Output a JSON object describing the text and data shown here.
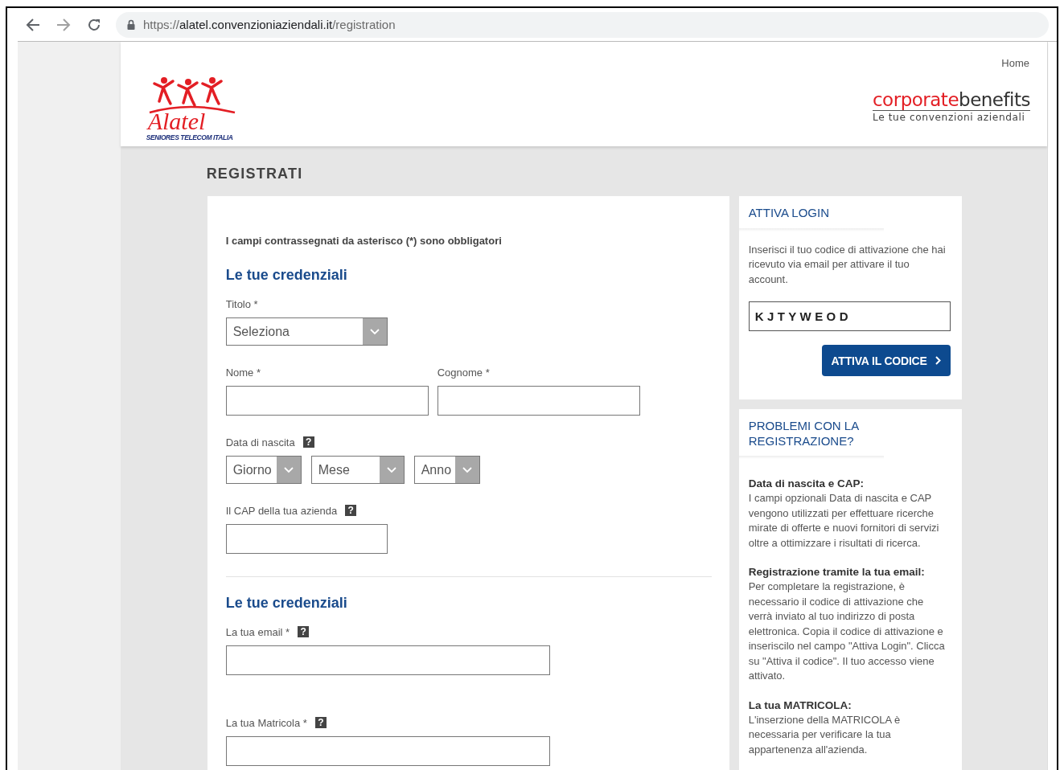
{
  "browser": {
    "url": {
      "scheme": "https://",
      "host": "alatel.convenzioniaziendali.it",
      "path": "/registration"
    }
  },
  "header": {
    "nav_link": "Home",
    "logo": {
      "name": "Alatel",
      "tagline": "SENIORES TELECOM ITALIA"
    },
    "brand": {
      "part_1": "corporate",
      "part_2": "benefits",
      "tagline": "Le tue convenzioni aziendali"
    }
  },
  "page_title": "REGISTRATI",
  "form": {
    "note": "I campi contrassegnati da asterisco (*) sono obbligatori",
    "sections": [
      {
        "heading": "Le tue credenziali",
        "fields": [
          {
            "kind": "select",
            "label": "Titolo *",
            "value": "Seleziona"
          },
          {
            "kind": "text-pair",
            "fields": [
              {
                "label": "Nome *"
              },
              {
                "label": "Cognome *"
              }
            ]
          },
          {
            "kind": "date",
            "label": "Data di nascita",
            "help": "?",
            "selects": [
              "Giorno",
              "Mese",
              "Anno"
            ]
          },
          {
            "kind": "short-text",
            "label": "Il CAP della tua azienda",
            "help": "?"
          }
        ]
      },
      {
        "heading": "Le tue credenziali",
        "fields": [
          {
            "kind": "text",
            "label": "La tua email *",
            "help": "?"
          },
          {
            "kind": "text",
            "label": "La tua Matricola *",
            "help": "?"
          }
        ]
      }
    ]
  },
  "sidebar": [
    {
      "kind": "activation",
      "title": "ATTIVA LOGIN",
      "text": "Inserisci il tuo codice di attivazione che hai ricevuto via email per attivare il tuo account.",
      "code": "KJTYWEOD",
      "button": "ATTIVA IL CODICE"
    },
    {
      "kind": "help",
      "title": "PROBLEMI CON LA REGISTRAZIONE?",
      "items": [
        {
          "heading": "Data di nascita e CAP:",
          "text": "I campi opzionali Data di nascita e CAP vengono utilizzati per effettuare ricerche mirate di offerte e nuovi fornitori di servizi oltre a ottimizzare i risultati di ricerca."
        },
        {
          "heading": "Registrazione tramite la tua email:",
          "text": "Per completare la registrazione, è necessario il codice di attivazione che verrà inviato al tuo indirizzo di posta elettronica. Copia il codice di attivazione e inseriscilo nel campo \"Attiva Login\". Clicca su \"Attiva il codice\". Il tuo accesso viene attivato."
        },
        {
          "heading": "La tua MATRICOLA:",
          "text": "L'inserzione della MATRICOLA è necessaria per verificare la tua appartenenza all'azienda."
        }
      ]
    }
  ]
}
